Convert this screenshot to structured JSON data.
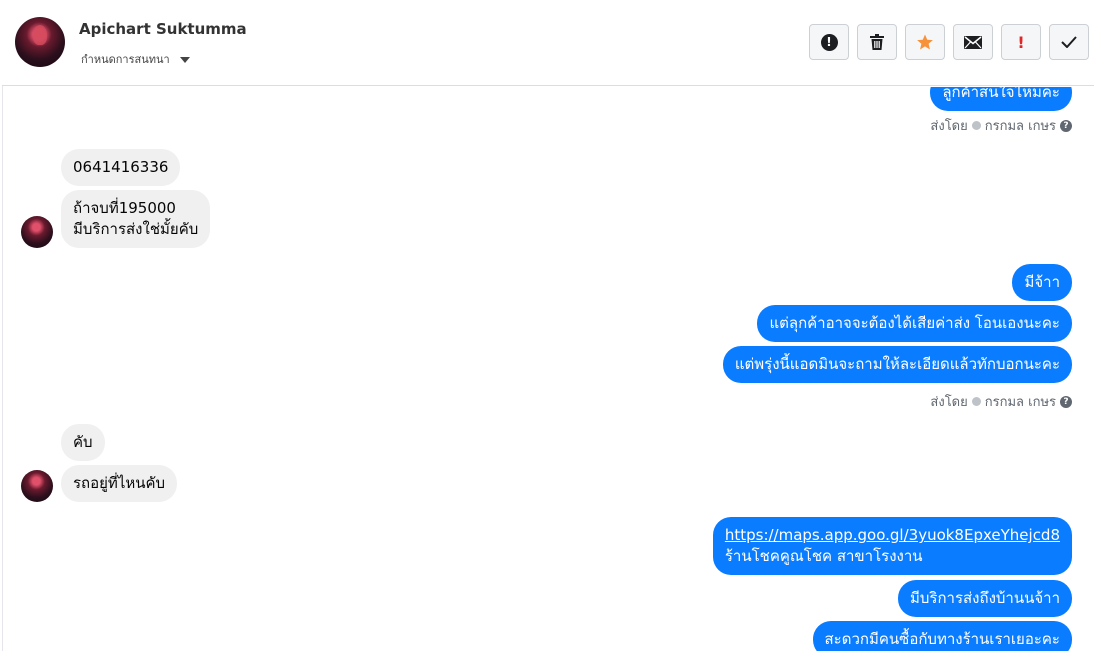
{
  "contact": {
    "name": "Apichart Suktumma",
    "assign_label": "กำหนดการสนทนา"
  },
  "toolbar": {
    "spam_icon": "!",
    "delete_icon": "trash-icon",
    "star_icon": "star-icon",
    "mail_icon": "envelope-icon",
    "flag_label": "!",
    "done_icon": "checkmark-icon"
  },
  "colors": {
    "outgoing": "#0a7cff",
    "incoming": "#f0f0f0",
    "star": "#f7923a",
    "flag": "#e02727"
  },
  "messages": {
    "m0": "ลูกค้าสนใจไหมคะ",
    "sent1_by": "ส่งโดย",
    "sent1_name": "กรกมล เกษร",
    "m1": "0641416336",
    "m2_line1": "ถ้าจบที่195000",
    "m2_line2": "มีบริการส่งใช่มั้ยคับ",
    "m3": "มีจ้าา",
    "m4": "แต่ลุกค้าอาจจะต้องได้เสียค่าส่ง โอนเองนะคะ",
    "m5": "แต่พรุ่งนี้แอดมินจะถามให้ละเอียดแล้วทักบอกนะคะ",
    "sent2_by": "ส่งโดย",
    "sent2_name": "กรกมล เกษร",
    "m6": "คับ",
    "m7": "รถอยู่ที่ไหนคับ",
    "m8_link": "https://maps.app.goo.gl/3yuok8EpxeYhejcd8",
    "m8_text": "ร้านโชคคูณโชค สาขาโรงงาน",
    "m9": "มีบริการส่งถึงบ้านนจ้าา",
    "m10": "สะดวกมีคนซื้อกับทางร้านเราเยอะคะ"
  }
}
